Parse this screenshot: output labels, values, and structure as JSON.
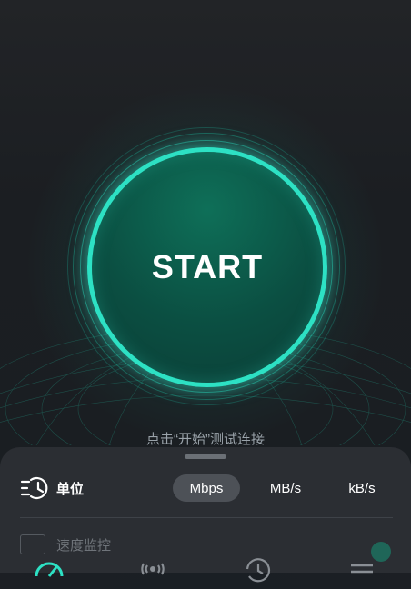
{
  "start_button": {
    "label": "START"
  },
  "hint_text": "点击“开始”测试连接",
  "unit_settings": {
    "title": "单位",
    "options": [
      "Mbps",
      "MB/s",
      "kB/s"
    ],
    "selected": "Mbps"
  },
  "speed_monitor": {
    "label": "速度监控"
  },
  "nav": {
    "items": [
      {
        "icon": "speedometer-icon",
        "active": true
      },
      {
        "icon": "signal-icon",
        "active": false
      },
      {
        "icon": "history-icon",
        "active": false
      },
      {
        "icon": "menu-icon",
        "active": false
      }
    ]
  },
  "colors": {
    "accent": "#2de1c4",
    "button_fill": "#0b4f42",
    "sheet": "#2b2e33"
  }
}
